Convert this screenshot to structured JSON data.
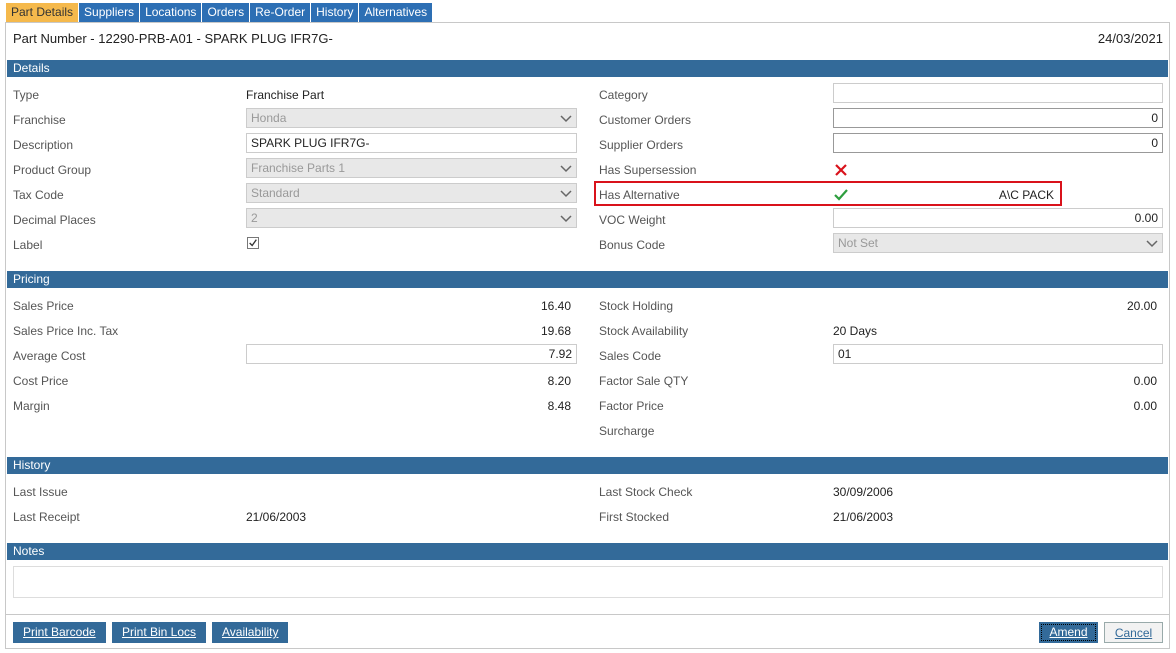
{
  "tabs": [
    "Part Details",
    "Suppliers",
    "Locations",
    "Orders",
    "Re-Order",
    "History",
    "Alternatives"
  ],
  "header": {
    "part": "Part Number - 12290-PRB-A01 - SPARK PLUG IFR7G-",
    "date": "24/03/2021"
  },
  "sections": {
    "details": "Details",
    "pricing": "Pricing",
    "history": "History",
    "notes": "Notes"
  },
  "details": {
    "type_label": "Type",
    "type_value": "Franchise Part",
    "franchise_label": "Franchise",
    "franchise_value": "Honda",
    "description_label": "Description",
    "description_value": "SPARK PLUG IFR7G-",
    "product_group_label": "Product Group",
    "product_group_value": "Franchise Parts 1",
    "tax_code_label": "Tax Code",
    "tax_code_value": "Standard",
    "decimal_places_label": "Decimal Places",
    "decimal_places_value": "2",
    "label_label": "Label",
    "label_checked": true,
    "category_label": "Category",
    "category_value": "",
    "customer_orders_label": "Customer Orders",
    "customer_orders_value": "0",
    "supplier_orders_label": "Supplier Orders",
    "supplier_orders_value": "0",
    "has_supersession_label": "Has Supersession",
    "has_supersession_icon": "cross-icon",
    "has_alternative_label": "Has Alternative",
    "has_alternative_icon": "check-icon",
    "has_alternative_value": "A\\C PACK",
    "voc_weight_label": "VOC Weight",
    "voc_weight_value": "0.00",
    "bonus_code_label": "Bonus Code",
    "bonus_code_value": "Not Set"
  },
  "pricing": {
    "sales_price_label": "Sales Price",
    "sales_price_value": "16.40",
    "sales_price_inc_label": "Sales Price Inc. Tax",
    "sales_price_inc_value": "19.68",
    "average_cost_label": "Average Cost",
    "average_cost_value": "7.92",
    "cost_price_label": "Cost Price",
    "cost_price_value": "8.20",
    "margin_label": "Margin",
    "margin_value": "8.48",
    "stock_holding_label": "Stock Holding",
    "stock_holding_value": "20.00",
    "stock_availability_label": "Stock Availability",
    "stock_availability_value": "20 Days",
    "sales_code_label": "Sales Code",
    "sales_code_value": "01",
    "factor_sale_qty_label": "Factor Sale QTY",
    "factor_sale_qty_value": "0.00",
    "factor_price_label": "Factor Price",
    "factor_price_value": "0.00",
    "surcharge_label": "Surcharge"
  },
  "history": {
    "last_issue_label": "Last Issue",
    "last_issue_value": "",
    "last_receipt_label": "Last Receipt",
    "last_receipt_value": "21/06/2003",
    "last_stock_check_label": "Last Stock Check",
    "last_stock_check_value": "30/09/2006",
    "first_stocked_label": "First Stocked",
    "first_stocked_value": "21/06/2003"
  },
  "buttons": {
    "print_barcode": "Print Barcode",
    "print_bin_locs": "Print Bin Locs",
    "availability": "Availability",
    "amend": "Amend",
    "cancel": "Cancel"
  },
  "colors": {
    "tab": "#2d6fb4",
    "tab_active": "#f5b94c",
    "section": "#336a99",
    "highlight": "#d9121b",
    "check": "#2e9e3e",
    "cross": "#d9121b"
  }
}
